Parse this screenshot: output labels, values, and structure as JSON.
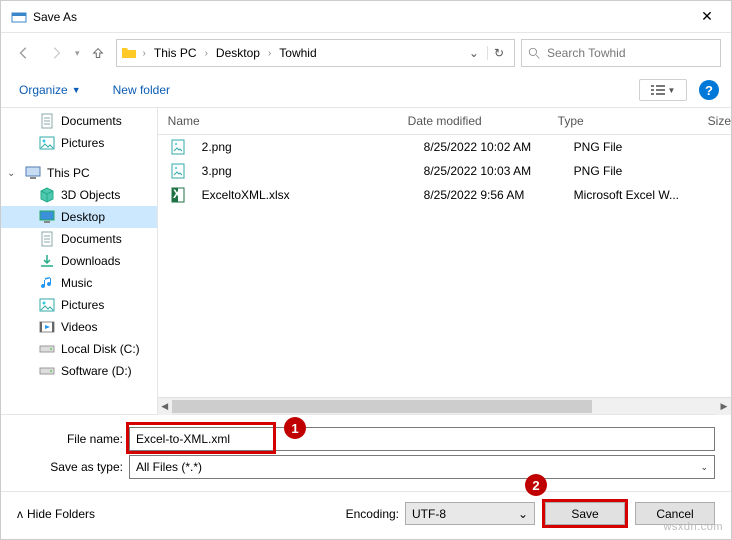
{
  "window": {
    "title": "Save As"
  },
  "breadcrumbs": {
    "root_chevron": "›",
    "pc": "This PC",
    "desktop": "Desktop",
    "folder": "Towhid"
  },
  "search": {
    "placeholder": "Search Towhid"
  },
  "toolbar": {
    "organize": "Organize",
    "new_folder": "New folder"
  },
  "columns": {
    "name": "Name",
    "date": "Date modified",
    "type": "Type",
    "size": "Size"
  },
  "sidebar": {
    "documents": "Documents",
    "pictures": "Pictures",
    "this_pc": "This PC",
    "objects3d": "3D Objects",
    "desktop": "Desktop",
    "sub_documents": "Documents",
    "downloads": "Downloads",
    "music": "Music",
    "sub_pictures": "Pictures",
    "videos": "Videos",
    "local_disk": "Local Disk (C:)",
    "software": "Software (D:)"
  },
  "files": [
    {
      "name": "2.png",
      "date": "8/25/2022 10:02 AM",
      "type": "PNG File",
      "icon": "image"
    },
    {
      "name": "3.png",
      "date": "8/25/2022 10:03 AM",
      "type": "PNG File",
      "icon": "image"
    },
    {
      "name": "ExceltoXML.xlsx",
      "date": "8/25/2022 9:56 AM",
      "type": "Microsoft Excel W...",
      "icon": "excel"
    }
  ],
  "form": {
    "file_name_label": "File name:",
    "file_name_value": "Excel-to-XML.xml",
    "save_as_type_label": "Save as type:",
    "save_as_type_value": "All Files  (*.*)"
  },
  "bottom": {
    "hide_folders": "Hide Folders",
    "encoding_label": "Encoding:",
    "encoding_value": "UTF-8",
    "save": "Save",
    "cancel": "Cancel"
  },
  "annotations": {
    "badge1": "1",
    "badge2": "2"
  },
  "watermark": "wsxdn.com"
}
